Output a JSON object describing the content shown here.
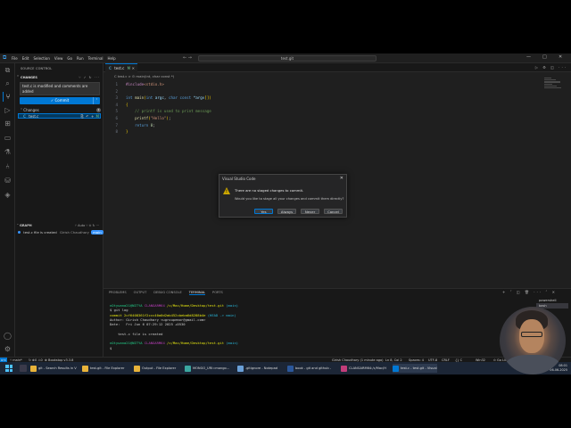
{
  "titlebar": {
    "menu": [
      "File",
      "Edit",
      "Selection",
      "View",
      "Go",
      "Run",
      "Terminal",
      "Help"
    ],
    "search": "test.git",
    "nav_arrows": "← →",
    "win_min": "—",
    "win_max": "□",
    "win_close": "✕"
  },
  "sidebar": {
    "heading": "SOURCE CONTROL",
    "section": "CHANGES",
    "section_tools": "⑂ ✓ ↻ ···",
    "commit_message": "test.c is modified and comments are added",
    "commit_button": "✓ Commit",
    "changes_label": "Changes",
    "changes_count": "1",
    "file": {
      "icon": "C",
      "name": "test.c",
      "actions": "⎘ ↶ +",
      "status": "M"
    },
    "graph": {
      "heading": "GRAPH",
      "tools": "⑂ Auto ⑂ ⊙ ↻ ···",
      "commit": "test.c file is created",
      "author": "Girish Chaudhary",
      "tag": "main"
    }
  },
  "editor": {
    "tab": {
      "icon": "C",
      "name": "test.c",
      "flag": "M",
      "close": "✕"
    },
    "tab_tools": "▷ ⚙ ◫ ···",
    "breadcrumb": "C  test.c  >  ⊙ main(int, char const *)",
    "minimap_lines": 6
  },
  "code": [
    {
      "n": "1",
      "parts": [
        [
          "pre",
          "#include"
        ],
        [
          "inc",
          "<stdio.h>"
        ]
      ]
    },
    {
      "n": "2",
      "parts": []
    },
    {
      "n": "3",
      "parts": [
        [
          "ty",
          "int "
        ],
        [
          "fn",
          "main"
        ],
        [
          "br",
          "("
        ],
        [
          "ty",
          "int "
        ],
        [
          "var",
          "argc"
        ],
        [
          "",
          ", "
        ],
        [
          "ty",
          "char const "
        ],
        [
          "var",
          "*argv"
        ],
        [
          "br",
          "[]"
        ],
        [
          "br",
          ")"
        ]
      ]
    },
    {
      "n": "4",
      "parts": [
        [
          "br",
          "{"
        ]
      ]
    },
    {
      "n": "5",
      "parts": [
        [
          "cm",
          "    // printf is used to print message"
        ]
      ]
    },
    {
      "n": "6",
      "parts": [
        [
          "",
          "    "
        ],
        [
          "fn",
          "printf"
        ],
        [
          "br",
          "("
        ],
        [
          "str",
          "\"Hello\""
        ],
        [
          "br",
          ")"
        ],
        [
          "",
          ";"
        ]
      ]
    },
    {
      "n": "7",
      "parts": [
        [
          "kw",
          "    return "
        ],
        [
          "num",
          "0"
        ],
        [
          "",
          ";"
        ]
      ]
    },
    {
      "n": "8",
      "parts": [
        [
          "br",
          "}"
        ]
      ]
    }
  ],
  "dialog": {
    "title": "Visual Studio Code",
    "close": "✕",
    "message": "There are no staged changes to commit.",
    "detail": "Would you like to stage all your changes and commit them directly?",
    "buttons": [
      "Yes",
      "Always",
      "Never",
      "Cancel"
    ]
  },
  "panel": {
    "tabs": [
      "PROBLEMS",
      "OUTPUT",
      "DEBUG CONSOLE",
      "TERMINAL",
      "PORTS"
    ],
    "tools": "+ ˅ ◫ 🗑 ··· ˄ ✕",
    "terminals": [
      "powershell",
      "bash"
    ],
    "prompt_user": "nOtyuana21@NITYA",
    "prompt_host": "CLANGARM64",
    "prompt_path": "/c/Mac/Home/Desktop/test.git",
    "prompt_branch": "(main)",
    "cmd1": "$ git log",
    "commit_line_label": "commit",
    "commit_hash": "2cf6408361f2ccc40a0d2ab452cbeba6d8288b4e",
    "commit_ref": "(HEAD -> main)",
    "author_line": "Author: Girish Chaudhary <ugroupemor@gmail.com>",
    "date_line": "Date:   Fri Jun 6 07:29:12 2025 +0530",
    "message_line": "    test.c file is created",
    "cmd2": "$ "
  },
  "statusbar": {
    "remote": "⊳<",
    "branch": "⑂ main*",
    "sync": "↻ ⊗0 ⚠0",
    "bookstop": "⊗ Bookstop v3.3.8",
    "author": "Girish Chaudhary (1 minute ago)",
    "position": "Ln 8, Col 2",
    "spaces": "Spaces: 4",
    "encoding": "UTF-8",
    "eol": "CRLF",
    "lang": "{} C",
    "platform": "Win32",
    "golive": "⊙ Go Live"
  },
  "taskbar": {
    "apps": [
      {
        "label": "git - Search Results in V",
        "color": "#e8b33a"
      },
      {
        "label": "test.git - File Explorer",
        "color": "#e8b33a"
      },
      {
        "label": "Output - File Explorer",
        "color": "#e8b33a"
      },
      {
        "label": "MONGO_URI=mongo...",
        "color": "#3ba7a0"
      },
      {
        "label": ".gitignore - Notepad",
        "color": "#6aa0d8"
      },
      {
        "label": "book - git and github -",
        "color": "#2b579a"
      },
      {
        "label": "CLANGARM64:/c/Mac/H",
        "color": "#c23d7a"
      },
      {
        "label": "test.c - test.git - Visual",
        "color": "#0078d4"
      }
    ],
    "time": "08:01",
    "date": "06-06-2025"
  },
  "colors": {
    "accent": "#0078d4",
    "warning": "#cca700",
    "modified": "#73c991"
  }
}
